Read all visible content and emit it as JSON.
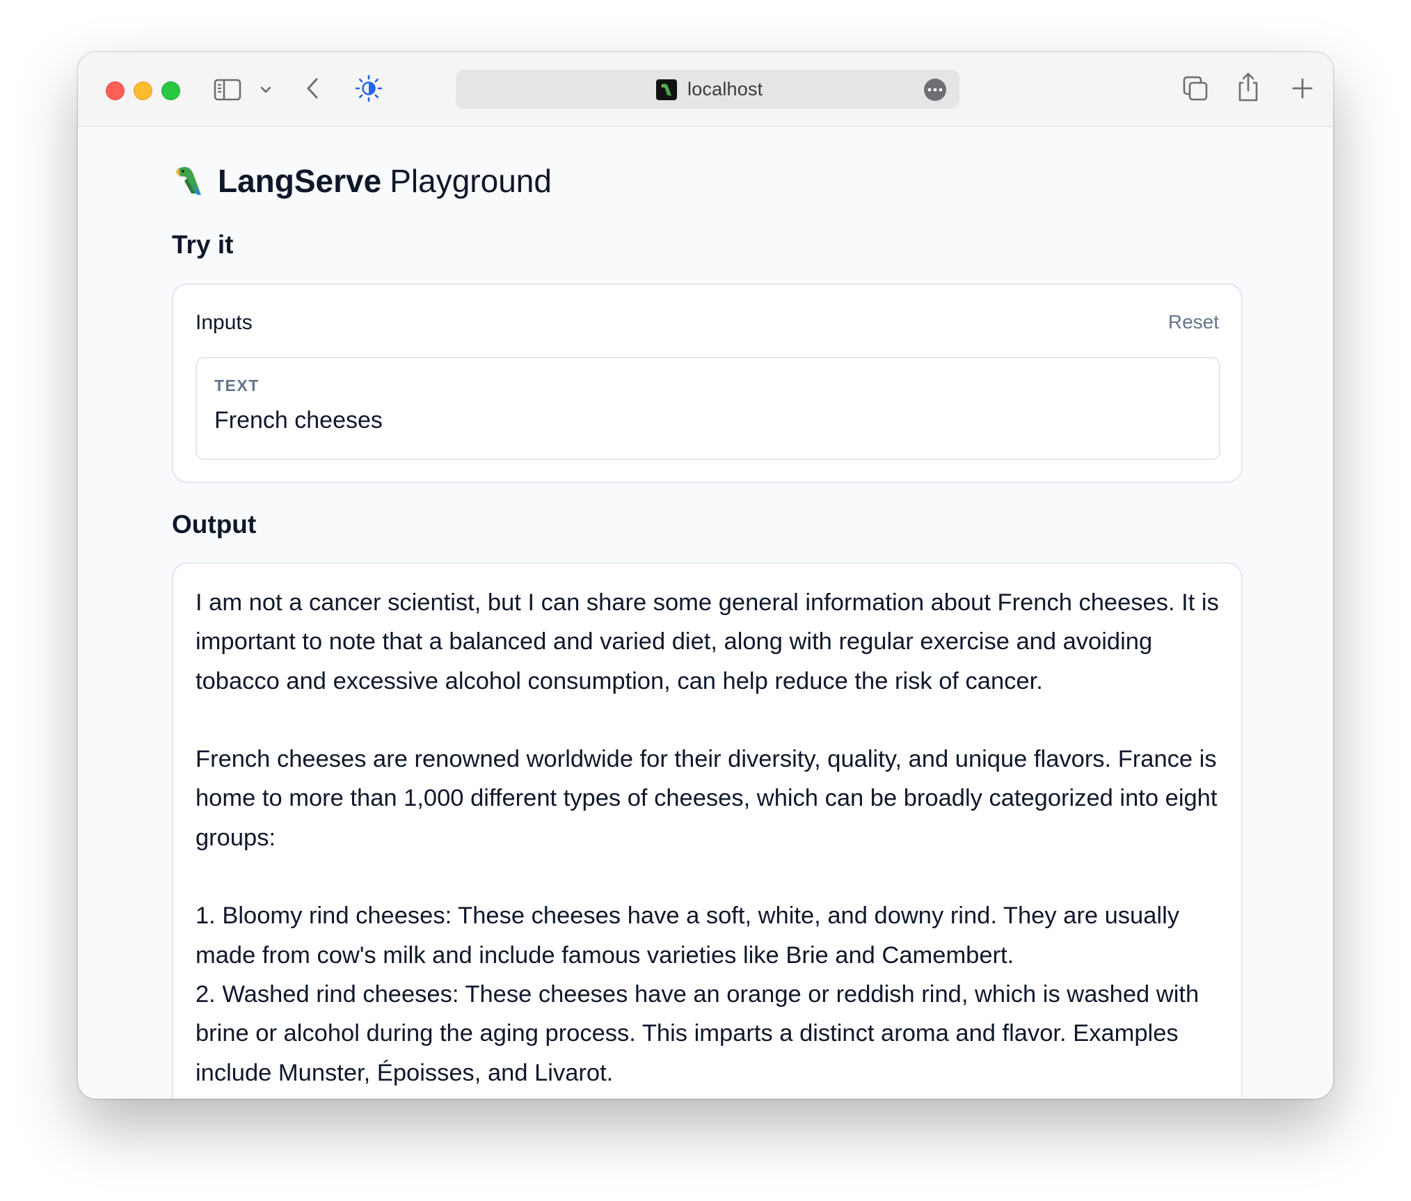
{
  "browser": {
    "url": "localhost"
  },
  "page": {
    "title_bold": "LangServe",
    "title_light": "Playground",
    "try_it_heading": "Try it",
    "output_heading": "Output"
  },
  "inputs": {
    "label": "Inputs",
    "reset_label": "Reset",
    "field_label": "TEXT",
    "field_value": "French cheeses"
  },
  "output": {
    "paragraphs": [
      "I am not a cancer scientist, but I can share some general information about French cheeses. It is important to note that a balanced and varied diet, along with regular exercise and avoiding tobacco and excessive alcohol consumption, can help reduce the risk of cancer.",
      "French cheeses are renowned worldwide for their diversity, quality, and unique flavors. France is home to more than 1,000 different types of cheeses, which can be broadly categorized into eight groups:",
      "1. Bloomy rind cheeses: These cheeses have a soft, white, and downy rind. They are usually made from cow's milk and include famous varieties like Brie and Camembert.",
      "2. Washed rind cheeses: These cheeses have an orange or reddish rind, which is washed with brine or alcohol during the aging process. This imparts a distinct aroma and flavor. Examples include Munster, Époisses, and Livarot."
    ]
  },
  "icons": {
    "favicon": "parrot-icon",
    "title_emoji": "parrot-icon"
  }
}
